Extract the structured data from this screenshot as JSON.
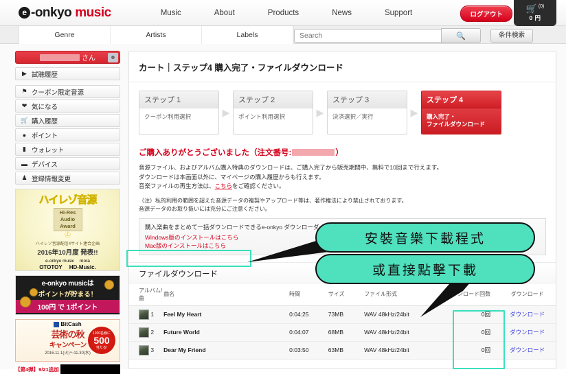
{
  "header": {
    "logo_e": "e",
    "logo_onkyo": "-onkyo",
    "logo_music": "music",
    "nav": [
      "Music",
      "About",
      "Products",
      "News",
      "Support"
    ],
    "logout_label": "ログアウト",
    "cart_icon": "cart-icon",
    "cart_count": "(0)",
    "cart_price": "0 円"
  },
  "subnav": {
    "tabs": [
      "Genre",
      "Artists",
      "Labels"
    ],
    "search_placeholder": "Search",
    "search_value": "",
    "search_icon": "search-icon",
    "advanced_label": "条件検索"
  },
  "sidebar": {
    "user_suffix": "さん",
    "user_icon": "user-avatar-icon",
    "history_item": {
      "icon": "triangle-right-icon",
      "label": "試聴履歴"
    },
    "items": [
      {
        "icon": "coupon-icon",
        "label": "クーポン限定音源"
      },
      {
        "icon": "heart-icon",
        "label": "気になる"
      },
      {
        "icon": "cart-icon",
        "label": "購入履歴"
      },
      {
        "icon": "point-icon",
        "label": "ポイント"
      },
      {
        "icon": "wallet-icon",
        "label": "ウォレット"
      },
      {
        "icon": "device-icon",
        "label": "デバイス"
      },
      {
        "icon": "person-icon",
        "label": "登録情報変更"
      }
    ],
    "banner_hires": {
      "title": "ハイレゾ音源",
      "award_l1": "Hi-Res",
      "award_l2": "Audio",
      "award_l3": "Award",
      "sub": "ハイレゾ音源配信4サイト連合企画",
      "date": "2016年10月度 発表!!",
      "logos_row1": [
        "e-onkyo music",
        "mora"
      ],
      "logos_row2": [
        "OTOTOY",
        "HD-Music."
      ]
    },
    "banner_point": {
      "line1": "e-onkyo musicは",
      "line2": "ポイントが貯まる！",
      "line3": "100円 で 1ポイント"
    },
    "banner_bitcash": {
      "brand": "BitCash",
      "title": "芸術の秋",
      "subtitle": "キャンペーン",
      "date": "2016.11.1(火)～11.30(水)",
      "badge_top": "1200名様に",
      "badge_amount": "500",
      "badge_unit": "円分",
      "badge_bottom": "当たる!"
    },
    "banner_dan": {
      "label": "【第4弾】9/21追加"
    }
  },
  "main": {
    "title": "カート｜ステップ4 購入完了・ファイルダウンロード",
    "steps": [
      {
        "head": "ステップ 1",
        "body": "クーポン利用選択",
        "active": false
      },
      {
        "head": "ステップ 2",
        "body": "ポイント利用選択",
        "active": false
      },
      {
        "head": "ステップ 3",
        "body": "決済選択／実行",
        "active": false
      },
      {
        "head": "ステップ 4",
        "body": "購入完了・\nファイルダウンロード",
        "active": true
      }
    ],
    "thanks_prefix": "ご購入ありがとうございました（注文番号:",
    "thanks_suffix": "）",
    "desc_line1": "音源ファイル、およびアルバム購入特典のダウンロードは、ご購入完了から販売期間中、無料で10回まで行えます。",
    "desc_line2": "ダウンロードは本画面以外に、マイページの購入履歴からも行えます。",
    "desc_line3_a": "音楽ファイルの再生方法は、",
    "desc_line3_link": "こちら",
    "desc_line3_b": "をご確認ください。",
    "note_line1": "（注）私的利用の範囲を超えた音源データの複製やアップロード等は、著作権法により禁止されております。",
    "note_line2": "音源データのお取り扱いには充分にご注意ください。",
    "downloader": {
      "description": "購入楽曲をまとめて一括ダウンロードできるe-onkyo ダウンローダー",
      "win_link": "Windows版のインストールはこちら",
      "mac_link": "Mac版のインストールはこちら"
    },
    "file_download": {
      "section_title": "ファイルダウンロード",
      "columns": [
        "アルバム/曲",
        "曲名",
        "時間",
        "サイズ",
        "ファイル形式",
        "ダウンロード回数",
        "ダウンロード"
      ],
      "rows": [
        {
          "thumb": "album-thumbnail",
          "index": "1",
          "name": "Feel My Heart",
          "time": "0:04:25",
          "size": "73MB",
          "format": "WAV 48kHz/24bit",
          "count": "0回",
          "download_label": "ダウンロード"
        },
        {
          "thumb": "album-thumbnail",
          "index": "2",
          "name": "Future World",
          "time": "0:04:07",
          "size": "68MB",
          "format": "WAV 48kHz/24bit",
          "count": "0回",
          "download_label": "ダウンロード"
        },
        {
          "thumb": "album-thumbnail",
          "index": "3",
          "name": "Dear My Friend",
          "time": "0:03:50",
          "size": "63MB",
          "format": "WAV 48kHz/24bit",
          "count": "0回",
          "download_label": "ダウンロード"
        }
      ]
    }
  },
  "annotations": {
    "bubble1": "安裝音樂下載程式",
    "bubble2": "或直接點擊下載",
    "highlight_color": "#3ae0bd"
  }
}
